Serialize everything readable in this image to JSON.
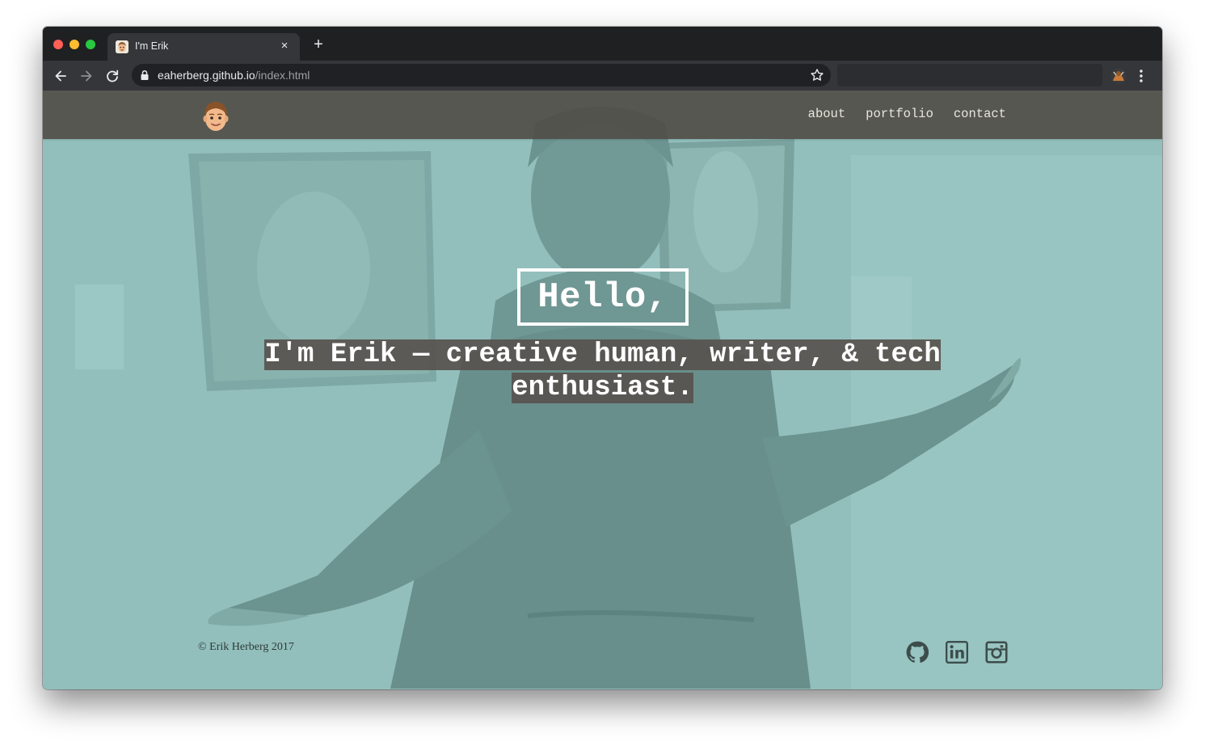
{
  "browser": {
    "tab_title": "I'm Erik",
    "tab_close": "×",
    "new_tab": "+",
    "url_host": "eaherberg.github.io",
    "url_path": "/index.html"
  },
  "site": {
    "nav": [
      "about",
      "portfolio",
      "contact"
    ],
    "hero": {
      "greeting": "Hello,",
      "tagline": "I'm Erik — creative human, writer, & tech enthusiast."
    },
    "footer": {
      "copyright": "© Erik Herberg 2017",
      "social_icons": [
        "github-icon",
        "linkedin-icon",
        "instagram-icon"
      ]
    }
  },
  "colors": {
    "overlay": "#8fbcb9",
    "header": "#524f48",
    "tagline_highlight": "#58524e"
  }
}
